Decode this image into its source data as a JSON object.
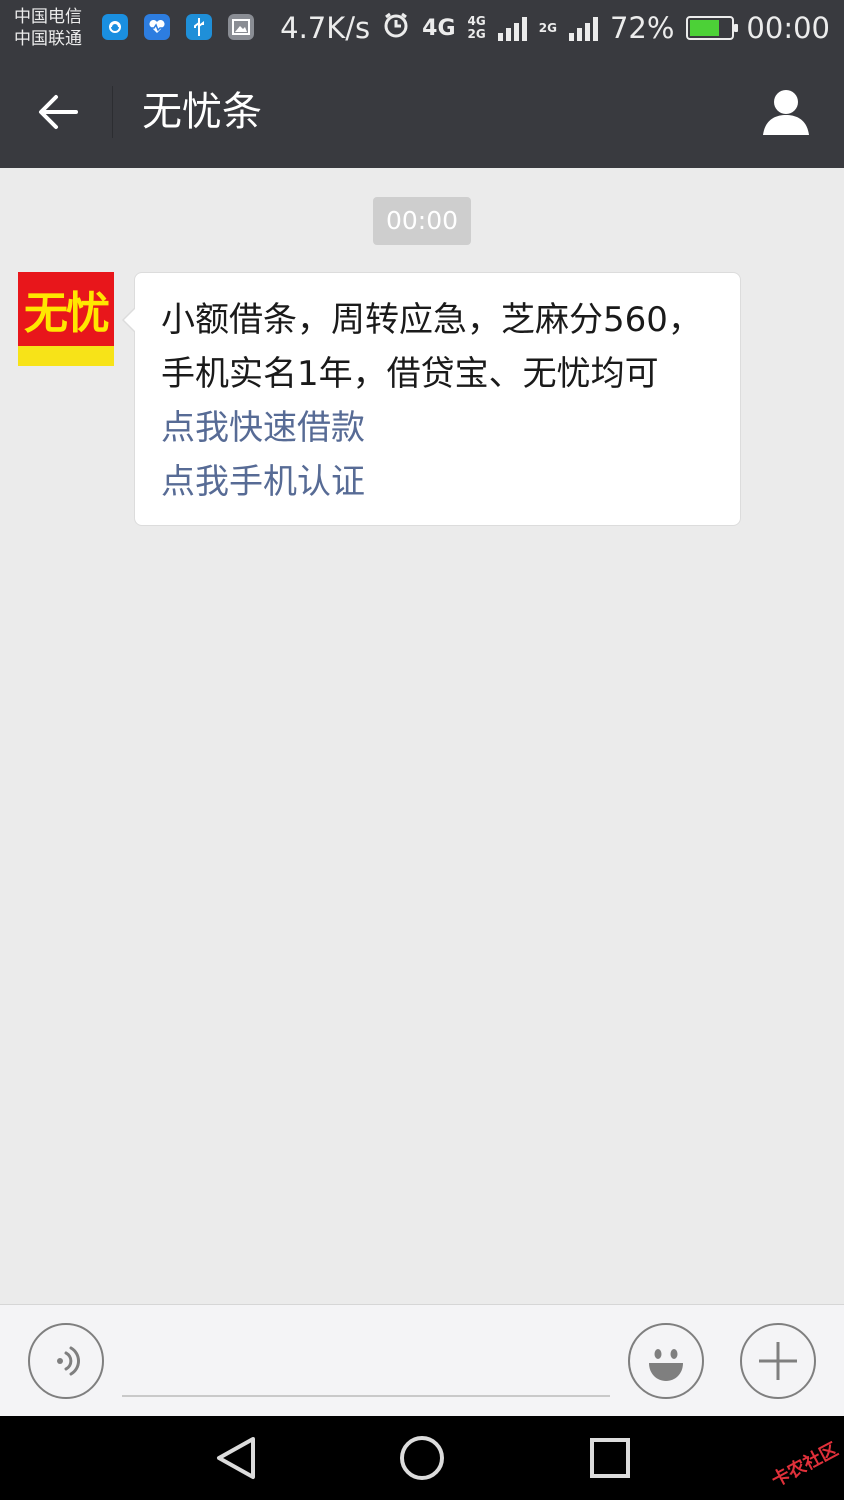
{
  "status_bar": {
    "carrier_1": "中国电信",
    "carrier_2": "中国联通",
    "net_speed": "4.7K/s",
    "network_primary": "4G",
    "network_stack_a_top": "4G",
    "network_stack_a_bottom": "2G",
    "network_stack_b": "2G",
    "battery_percent": "72%",
    "battery_level": 0.72,
    "time": "00:00",
    "icons": [
      "cloud-icon",
      "health-icon",
      "usb-icon",
      "gallery-icon",
      "alarm-icon",
      "signal-icon",
      "battery-icon"
    ]
  },
  "header": {
    "title": "无忧条"
  },
  "chat": {
    "timestamp": "00:00",
    "avatar_text": "无忧",
    "message": {
      "line_1": "小额借条，周转应急，芝麻分560，",
      "line_2": "手机实名1年，借贷宝、无忧均可",
      "link_1": "点我快速借款",
      "link_2": "点我手机认证"
    }
  },
  "input_bar": {
    "placeholder": ""
  },
  "watermark": "卡农社区",
  "colors": {
    "bar_dark": "#393a3f",
    "chat_bg": "#ebebeb",
    "link": "#576b95",
    "avatar_red": "#e8161b",
    "avatar_yellow": "#f7e318"
  }
}
